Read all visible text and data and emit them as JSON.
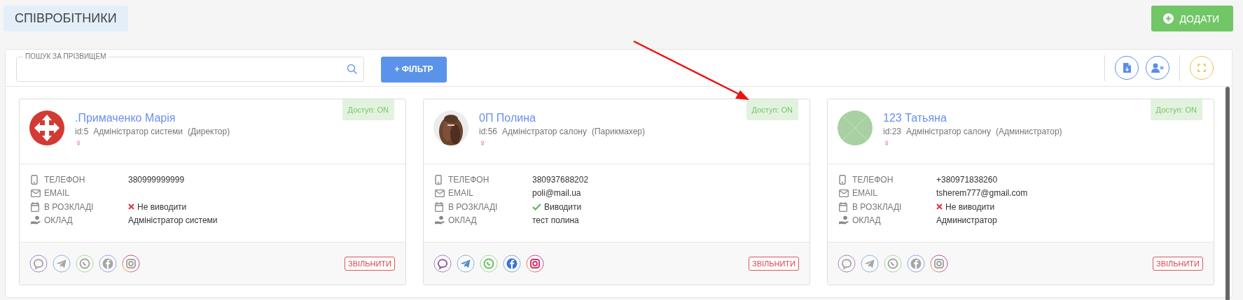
{
  "page_title": "СПІВРОБІТНИКИ",
  "add_button": "ДОДАТИ",
  "search": {
    "label": "ПОШУК ЗА ПРІЗВИЩЕМ"
  },
  "filter_button": "+ ФІЛЬТР",
  "employees": [
    {
      "name": ".Примаченко Марія",
      "id": "id:5",
      "role": "Адміністратор системи",
      "position": "(Директор)",
      "gender": "♀",
      "access": "Доступ: ON",
      "avatar": {
        "kind": "logo"
      },
      "fields": [
        {
          "kind": "phone",
          "label": "ТЕЛЕФОН",
          "value": "380999999999"
        },
        {
          "kind": "email",
          "label": "EMAIL"
        },
        {
          "kind": "schedule",
          "label": "В РОЗКЛАДІ",
          "checked": false,
          "value": "Не виводити"
        },
        {
          "kind": "salary",
          "label": "ОКЛАД",
          "value": "Адміністратор системи"
        }
      ],
      "socials_active": false,
      "dismiss_button": "ЗВІЛЬНИТИ"
    },
    {
      "name": "0П Полина",
      "id": "id:56",
      "role": "Адміністратор салону",
      "position": "(Парикмахер)",
      "gender": "♀",
      "access": "Доступ: ON",
      "fields": [
        {
          "kind": "phone",
          "label": "ТЕЛЕФОН",
          "value": "380937688202"
        },
        {
          "kind": "email",
          "label": "EMAIL",
          "value": "poli@mail.ua"
        },
        {
          "kind": "schedule",
          "label": "В РОЗКЛАДІ",
          "checked": true,
          "value": "Виводити"
        },
        {
          "kind": "salary",
          "label": "ОКЛАД",
          "value": "тест полина"
        }
      ],
      "socials_active": true,
      "dismiss_button": "ЗВІЛЬНИТИ"
    },
    {
      "name": "123 Татьяна",
      "id": "id:23",
      "role": "Адміністратор салону",
      "position": "(Администратор)",
      "gender": "♀",
      "access": "Доступ: ON",
      "avatar": {
        "kind": "placeholder"
      },
      "fields": [
        {
          "kind": "phone",
          "label": "ТЕЛЕФОН",
          "value": "+380971838260"
        },
        {
          "kind": "email",
          "label": "EMAIL",
          "value": "tsherem777@gmail.com"
        },
        {
          "kind": "schedule",
          "label": "В РОЗКЛАДІ",
          "checked": false,
          "value": "Не виводити"
        },
        {
          "kind": "salary",
          "label": "ОКЛАД",
          "value": "Администратор"
        }
      ],
      "socials_active": false,
      "dismiss_button": "ЗВІЛЬНИТИ"
    }
  ]
}
